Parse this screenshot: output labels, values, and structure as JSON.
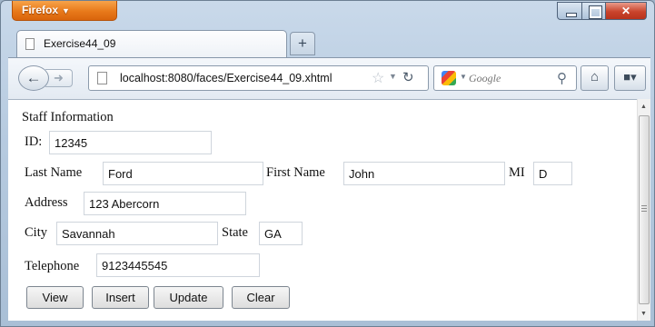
{
  "browser": {
    "app_button_label": "Firefox",
    "new_tab_glyph": "+",
    "tab_title": "Exercise44_09",
    "url": "localhost:8080/faces/Exercise44_09.xhtml",
    "search_placeholder": "Google",
    "icons": [
      "page-icon",
      "back-arrow-icon",
      "forward-arrow-icon",
      "bookmark-star-icon",
      "reload-icon",
      "google-engine-icon",
      "magnifier-icon",
      "home-icon",
      "addon-icon"
    ]
  },
  "form": {
    "heading": "Staff Information",
    "id_label": "ID:",
    "id_value": "12345",
    "last_name_label": "Last Name",
    "last_name_value": "Ford",
    "first_name_label": "First Name",
    "first_name_value": "John",
    "mi_label": "MI",
    "mi_value": "D",
    "address_label": "Address",
    "address_value": "123 Abercorn",
    "city_label": "City",
    "city_value": "Savannah",
    "state_label": "State",
    "state_value": "GA",
    "telephone_label": "Telephone",
    "telephone_value": "9123445545"
  },
  "buttons": {
    "view": "View",
    "insert": "Insert",
    "update": "Update",
    "clear": "Clear"
  },
  "colors": {
    "firefox_orange": "#e8791a",
    "close_red": "#c9442c",
    "chrome_blue": "#b7cbe0"
  }
}
